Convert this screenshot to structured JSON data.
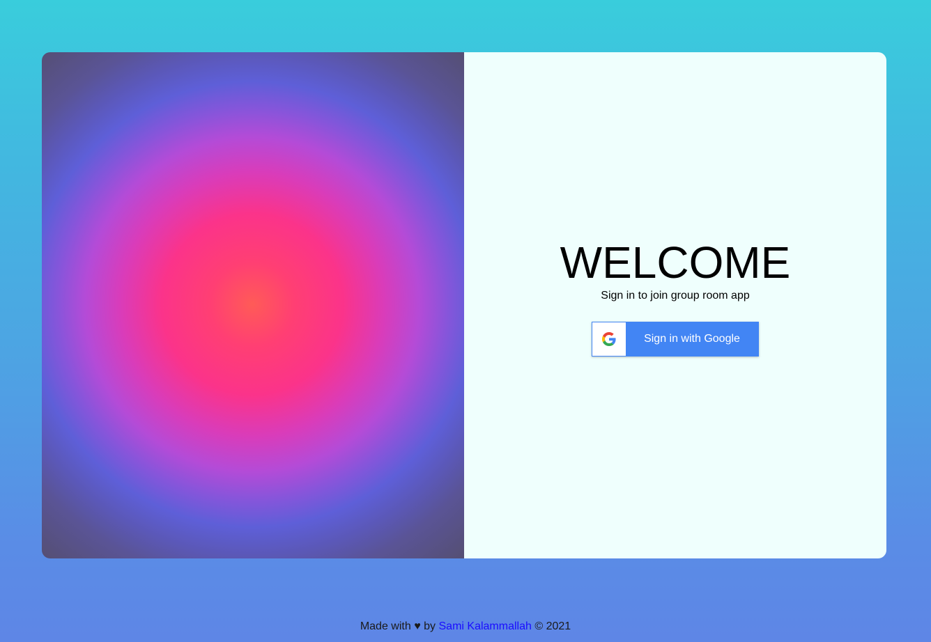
{
  "welcome": {
    "title": "WELCOME",
    "subtitle": "Sign in to join group room app"
  },
  "google_button": {
    "label": "Sign in with Google",
    "icon": "google-g-icon"
  },
  "footer": {
    "prefix": "Made with",
    "heart": "♥",
    "by": "by",
    "author": "Sami Kalammallah",
    "suffix": "© 2021"
  },
  "colors": {
    "background_top": "#39cddc",
    "background_bottom": "#5e86e6",
    "panel_bg": "#effffd",
    "button_blue": "#4285f4",
    "link": "#1a0dff"
  }
}
